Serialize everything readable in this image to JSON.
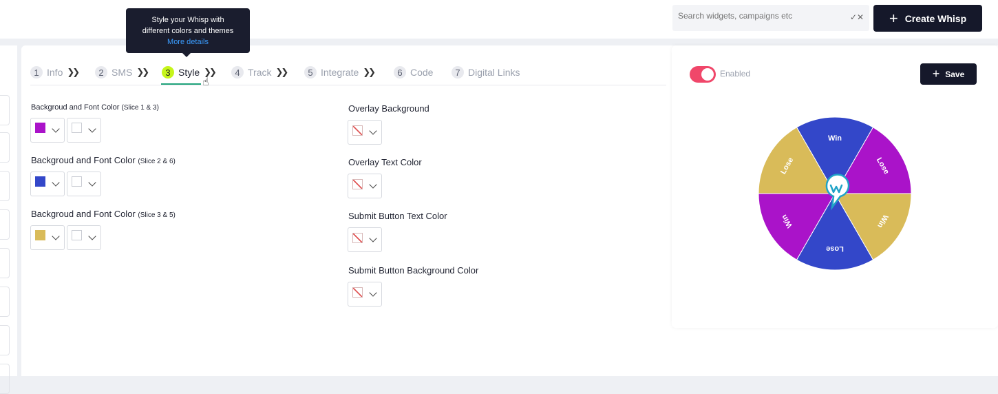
{
  "search": {
    "placeholder": "Search widgets, campaigns etc",
    "clear_icon": "x-clear-icon"
  },
  "header": {
    "create_label": "Create Whisp"
  },
  "tooltip": {
    "line1": "Style your Whisp with",
    "line2": "different colors and themes",
    "link": "More details"
  },
  "steps": [
    {
      "num": "1",
      "label": "Info"
    },
    {
      "num": "2",
      "label": "SMS"
    },
    {
      "num": "3",
      "label": "Style"
    },
    {
      "num": "4",
      "label": "Track"
    },
    {
      "num": "5",
      "label": "Integrate"
    },
    {
      "num": "6",
      "label": "Code"
    },
    {
      "num": "7",
      "label": "Digital Links"
    }
  ],
  "active_step": 3,
  "left_colors": [
    {
      "label": "Backgroud and Font Color",
      "sub": "(Slice 1 & 3)",
      "bg": "#aa13c9"
    },
    {
      "label": "Backgroud and Font Color",
      "sub": "(Slice 2 & 6)",
      "bg": "#3347c9"
    },
    {
      "label": "Backgroud and Font Color",
      "sub": "(Slice 3 & 5)",
      "bg": "#d9bb59"
    }
  ],
  "right_colors": [
    {
      "label": "Overlay Background"
    },
    {
      "label": "Overlay Text Color"
    },
    {
      "label": "Submit Button Text Color"
    },
    {
      "label": "Submit Button Background Color"
    }
  ],
  "panel": {
    "toggle_label": "Enabled",
    "toggle_on": true,
    "save_label": "Save"
  },
  "wheel": {
    "slices": [
      {
        "label": "Win",
        "color": "#3347c9"
      },
      {
        "label": "Lose",
        "color": "#aa13c9"
      },
      {
        "label": "Win",
        "color": "#d9bb59"
      },
      {
        "label": "Lose",
        "color": "#3347c9"
      },
      {
        "label": "Win",
        "color": "#aa13c9"
      },
      {
        "label": "Lose",
        "color": "#d9bb59"
      }
    ],
    "center_icon": "whisp-logo-pin-icon"
  }
}
